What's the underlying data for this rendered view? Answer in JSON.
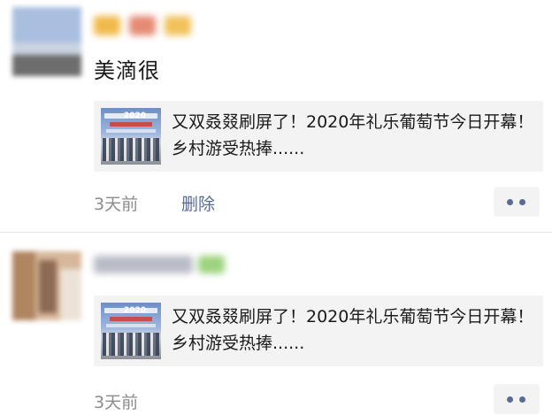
{
  "moments": [
    {
      "author_name": "",
      "text": "美滴很",
      "share": {
        "title": "又双叒叕刷屏了！2020年礼乐葡萄节今日开幕！乡村游受热捧......",
        "thumb_caption": "2020"
      },
      "time": "3天前",
      "delete_label": "删除",
      "more_icon": "more-dots-icon"
    },
    {
      "author_name": "",
      "share": {
        "title": "又双叒叕刷屏了！2020年礼乐葡萄节今日开幕！乡村游受热捧......",
        "thumb_caption": "2020"
      },
      "time": "3天前",
      "more_icon": "more-dots-icon"
    }
  ],
  "colors": {
    "link": "#576b95",
    "meta": "#8c8c8c",
    "card_bg": "#f3f3f3",
    "text": "#1a1a1a"
  }
}
